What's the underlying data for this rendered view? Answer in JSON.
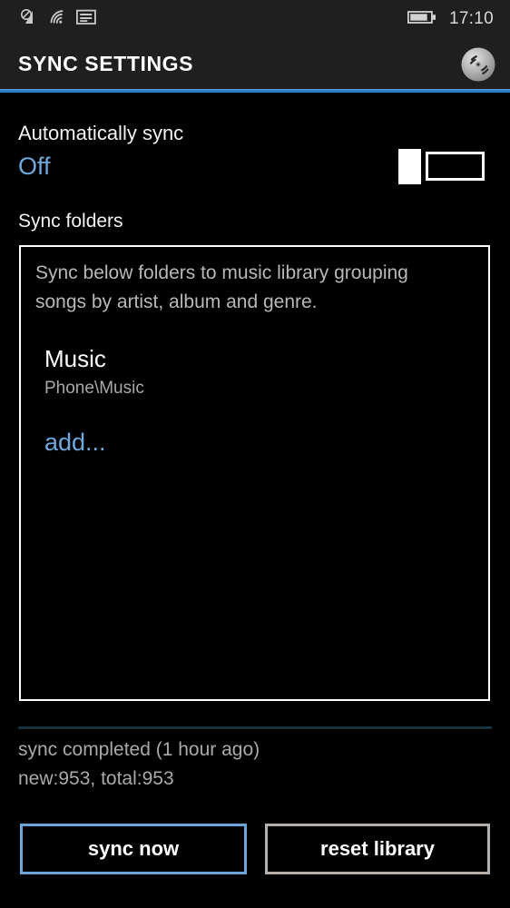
{
  "statusbar": {
    "icons": [
      {
        "name": "cellular-no-signal-icon",
        "label": "cellular"
      },
      {
        "name": "wifi-icon",
        "label": "wifi"
      },
      {
        "name": "sim-card-icon",
        "label": "sim"
      }
    ],
    "battery_icon": "battery-icon",
    "clock": "17:10"
  },
  "header": {
    "title": "SYNC SETTINGS",
    "app_icon": "cd-disc-icon",
    "accent_color": "#2a7fc9"
  },
  "auto_sync": {
    "label": "Automatically sync",
    "value": "Off",
    "toggle_state": "off",
    "value_color": "#6fa8dc"
  },
  "sync_folders": {
    "section_label": "Sync folders",
    "description": "Sync below folders to music library grouping songs by artist, album and genre.",
    "items": [
      {
        "name": "Music",
        "path": "Phone\\Music"
      }
    ],
    "add_label": "add..."
  },
  "status": {
    "line1": "sync completed (1 hour ago)",
    "line2": "new:953, total:953"
  },
  "actions": {
    "sync_now_label": "sync now",
    "sync_now_border": "#6ba5d8",
    "reset_library_label": "reset library",
    "reset_library_border": "#b5b0ac"
  }
}
